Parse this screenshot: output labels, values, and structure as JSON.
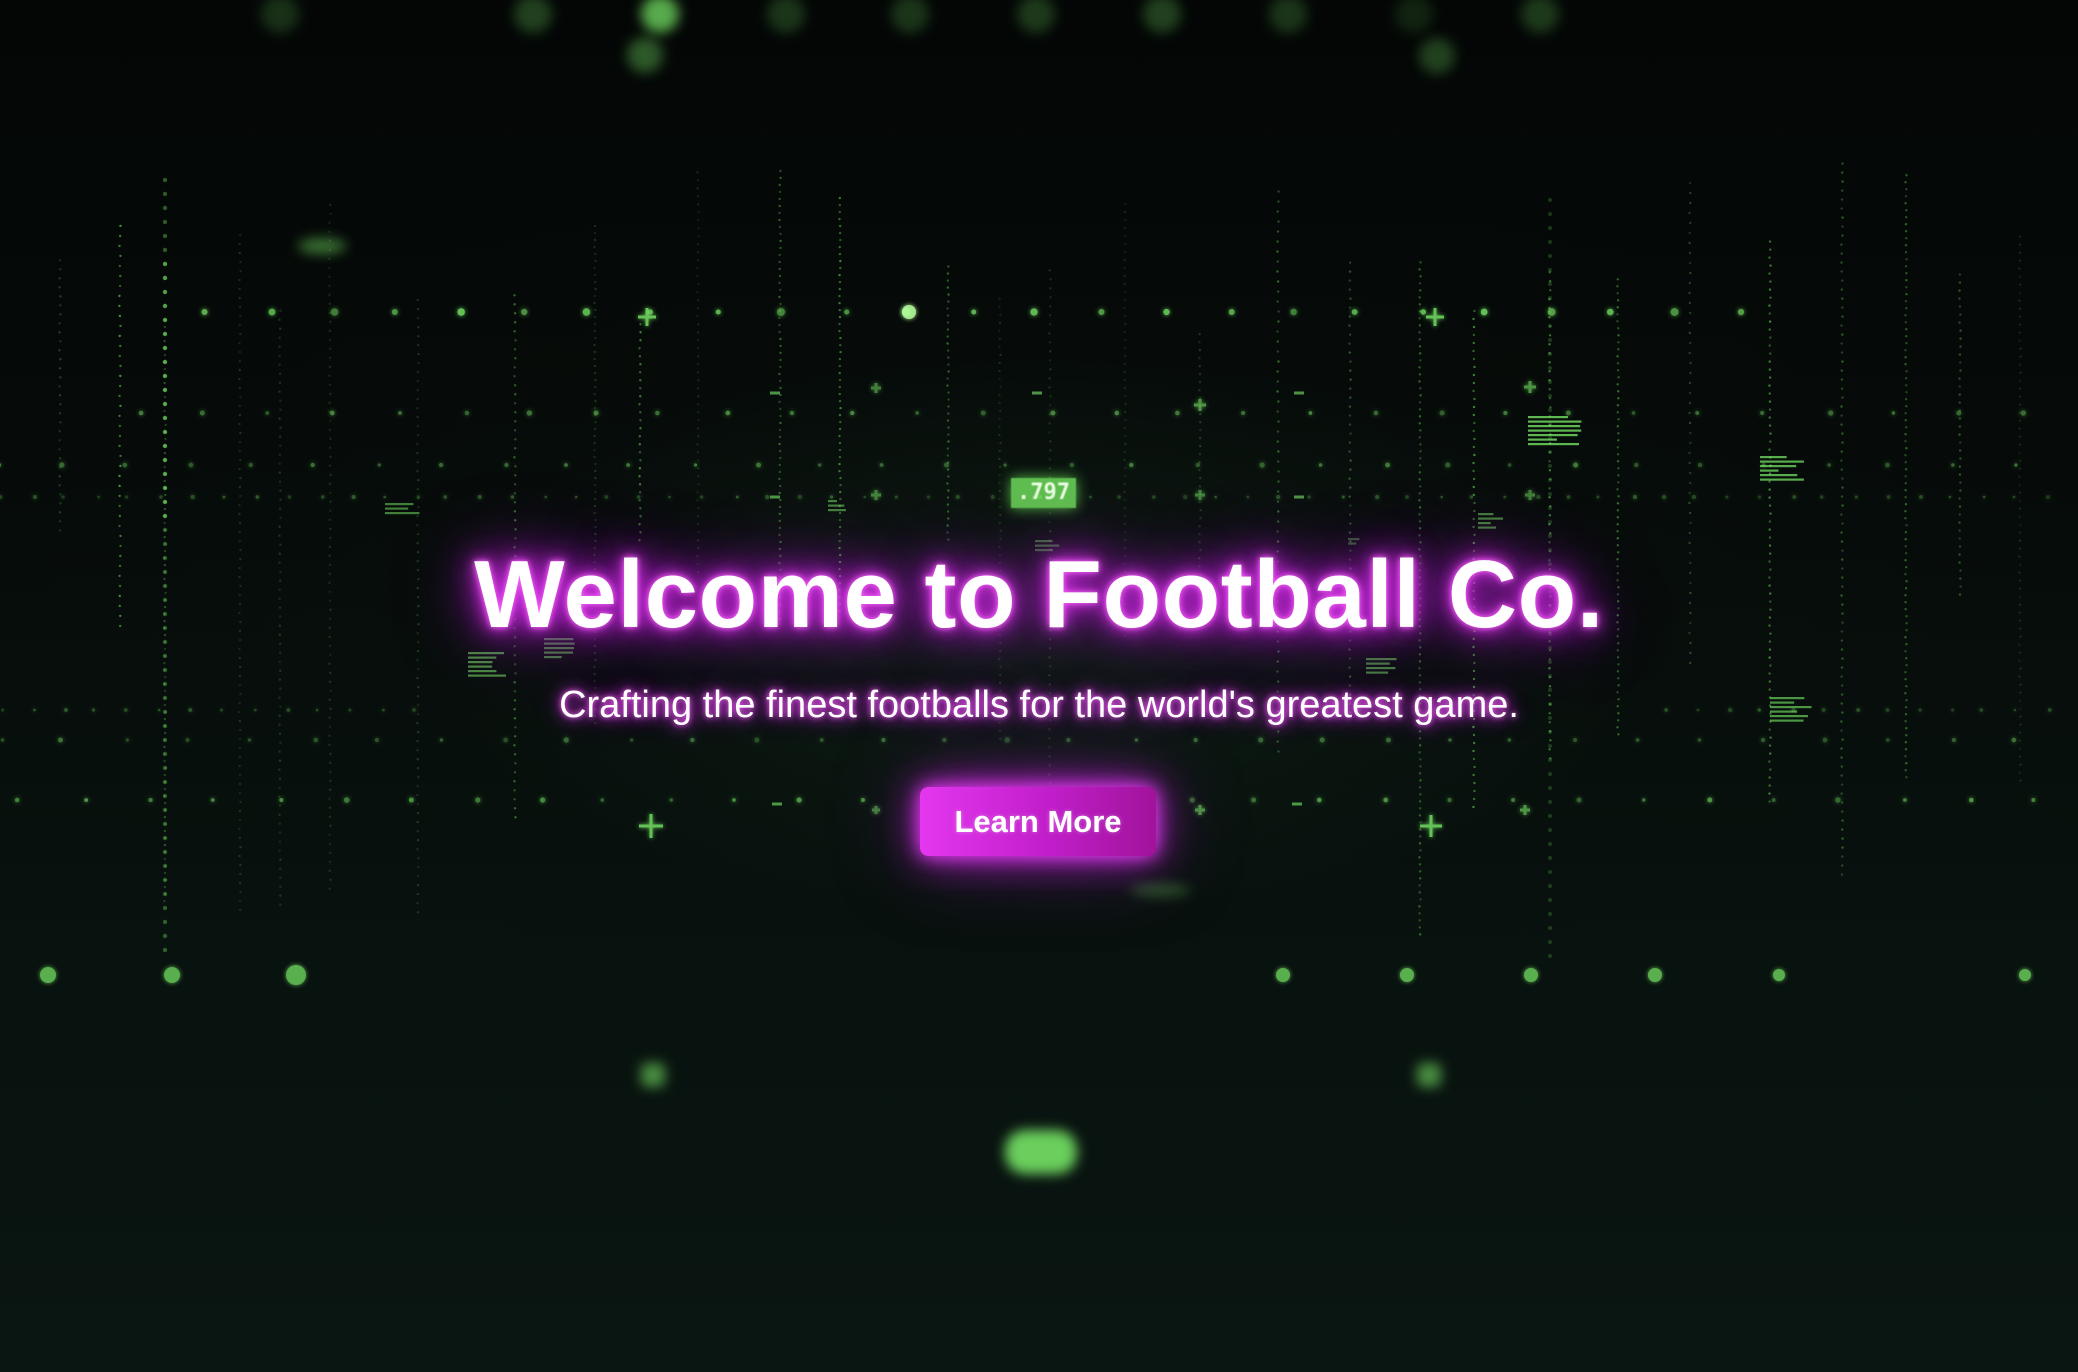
{
  "hero": {
    "badge_number": ".797",
    "title": "Welcome to Football Co.",
    "subtitle": "Crafting the finest footballs for the world's greatest game.",
    "cta_label": "Learn More"
  },
  "colors": {
    "background": "#050807",
    "glow_magenta": "#e23cf0",
    "button": "#d22ae0",
    "particle_green": "#7cf06a"
  }
}
